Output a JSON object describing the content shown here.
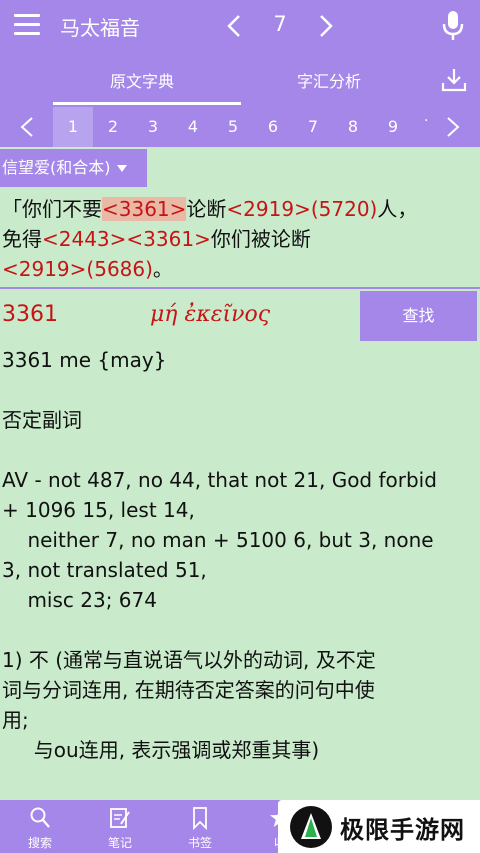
{
  "header": {
    "title": "马太福音",
    "chapter": "7"
  },
  "tabs": [
    {
      "label": "原文字典",
      "active": true
    },
    {
      "label": "字汇分析",
      "active": false
    }
  ],
  "verses": {
    "numbers": [
      "1",
      "2",
      "3",
      "4",
      "5",
      "6",
      "7",
      "8",
      "9"
    ],
    "active": "1",
    "overflow": "·"
  },
  "version": {
    "selected": "信望爱(和合本)"
  },
  "verse_text": [
    [
      {
        "t": "「你们不要",
        "c": "text"
      },
      {
        "t": "<3361>",
        "c": "ref hl"
      },
      {
        "t": "论断",
        "c": "text"
      },
      {
        "t": "<2919>(5720)",
        "c": "ref"
      },
      {
        "t": "人，",
        "c": "text"
      }
    ],
    [
      {
        "t": "免得",
        "c": "text"
      },
      {
        "t": "<2443><3361>",
        "c": "ref"
      },
      {
        "t": "你们被论断",
        "c": "text"
      }
    ],
    [
      {
        "t": "<2919>(5686)",
        "c": "ref"
      },
      {
        "t": "。",
        "c": "text"
      }
    ]
  ],
  "strongs": {
    "number": "3361",
    "greek": "μή ἐκεῖνος",
    "find_label": "查找"
  },
  "definition": [
    "3361 me {may}",
    "",
    "否定副词",
    "",
    "AV - not 487, no 44, that not 21, God forbid",
    "+ 1096 15, lest 14,",
    "    neither 7, no man + 5100 6, but 3, none",
    "3, not translated 51,",
    "    misc 23; 674",
    "",
    "1) 不 (通常与直说语气以外的动词, 及不定",
    "词与分词连用, 在期待否定答案的问句中使",
    "用;",
    "     与ou连用, 表示强调或郑重其事)"
  ],
  "bottom_nav": [
    {
      "label": "搜索",
      "icon": "search-icon"
    },
    {
      "label": "笔记",
      "icon": "note-icon"
    },
    {
      "label": "书签",
      "icon": "bookmark-icon"
    },
    {
      "label": "收",
      "icon": "star-icon"
    }
  ],
  "watermark": {
    "text": "极限手游网"
  },
  "colors": {
    "accent": "#a487e8",
    "background": "#c9ebcc",
    "ref": "#c61414"
  }
}
